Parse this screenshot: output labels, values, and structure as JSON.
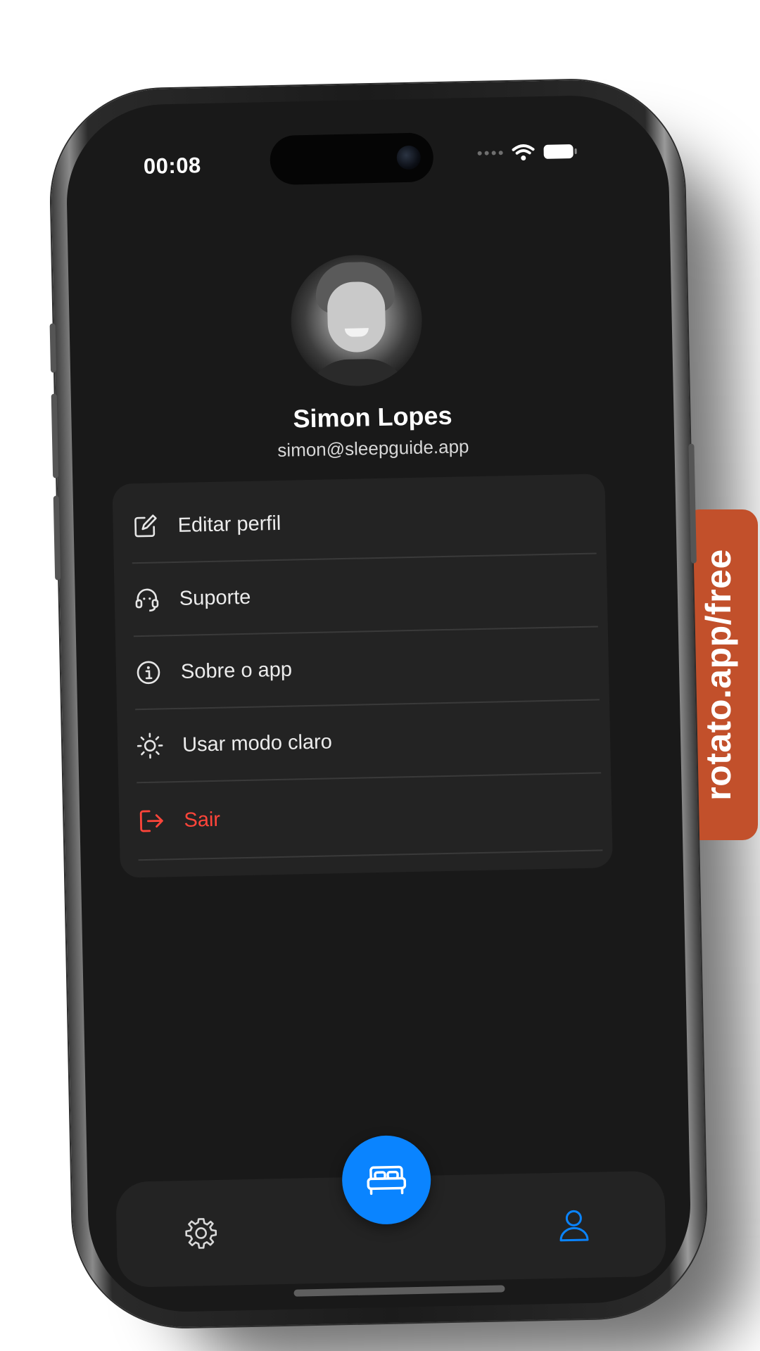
{
  "status_bar": {
    "time": "00:08"
  },
  "profile": {
    "name": "Simon Lopes",
    "email": "simon@sleepguide.app"
  },
  "menu": {
    "items": [
      {
        "label": "Editar perfil",
        "icon": "edit-icon"
      },
      {
        "label": "Suporte",
        "icon": "headset-icon"
      },
      {
        "label": "Sobre o app",
        "icon": "info-icon"
      },
      {
        "label": "Usar modo claro",
        "icon": "sun-icon"
      },
      {
        "label": "Sair",
        "icon": "logout-icon",
        "color": "#ff453a"
      }
    ]
  },
  "tabbar": {
    "items": [
      {
        "icon": "gear-icon"
      },
      {
        "icon": "bed-icon",
        "color": "#0a84ff"
      },
      {
        "icon": "user-icon",
        "color": "#0a84ff",
        "active": true
      }
    ]
  },
  "watermark": {
    "text": "rotato.app/free",
    "color": "#c2502b"
  }
}
